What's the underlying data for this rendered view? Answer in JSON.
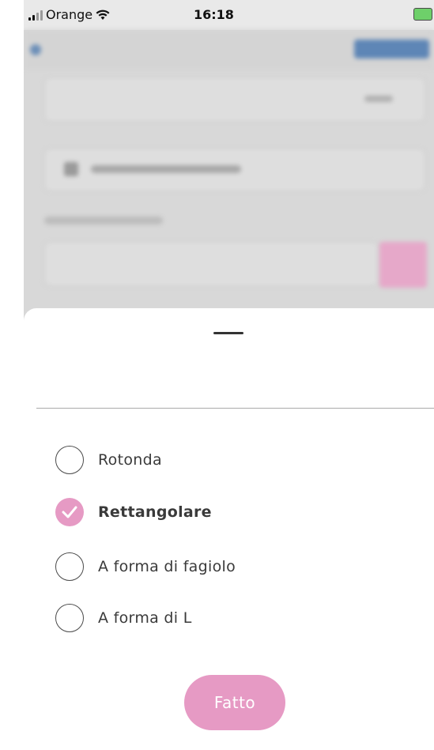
{
  "status_bar": {
    "carrier": "Orange",
    "time": "16:18"
  },
  "sheet": {
    "options": [
      {
        "label": "Rotonda",
        "selected": false
      },
      {
        "label": "Rettangolare",
        "selected": true
      },
      {
        "label": "A forma di fagiolo",
        "selected": false
      },
      {
        "label": "A forma di L",
        "selected": false
      }
    ],
    "done_label": "Fatto"
  },
  "colors": {
    "accent": "#e69ac4",
    "link_blue": "#5e86b6"
  }
}
